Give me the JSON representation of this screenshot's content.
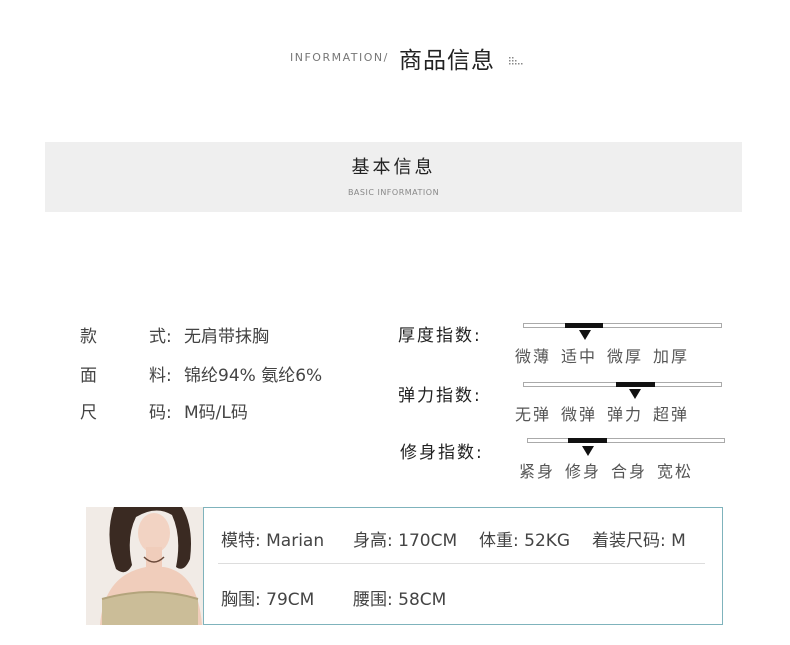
{
  "header": {
    "en": "INFORMATION/",
    "cn": "商品信息"
  },
  "banner": {
    "cn": "基本信息",
    "en": "BASIC INFORMATION"
  },
  "attributes": [
    {
      "k1": "款",
      "k2": "式:",
      "value": "无肩带抹胸"
    },
    {
      "k1": "面",
      "k2": "料:",
      "value": "锦纶94% 氨纶6%"
    },
    {
      "k1": "尺",
      "k2": "码:",
      "value": "M码/L码"
    }
  ],
  "indices": [
    {
      "label": "厚度指数:",
      "options": [
        "微薄",
        "适中",
        "微厚",
        "加厚"
      ],
      "selected_index": 1
    },
    {
      "label": "弹力指数:",
      "options": [
        "无弹",
        "微弹",
        "弹力",
        "超弹"
      ],
      "selected_index": 2
    },
    {
      "label": "修身指数:",
      "options": [
        "紧身",
        "修身",
        "合身",
        "宽松"
      ],
      "selected_index": 1
    }
  ],
  "model": {
    "name": "模特: Marian",
    "height": "身高: 170CM",
    "weight": "体重: 52KG",
    "size": "着装尺码: M",
    "bust": "胸围: 79CM",
    "waist": "腰围: 58CM"
  }
}
